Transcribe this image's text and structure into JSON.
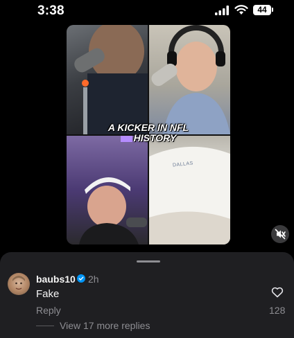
{
  "status_bar": {
    "time": "3:38",
    "battery": "44"
  },
  "video": {
    "caption_line1": "A KICKER IN NFL",
    "caption_line2": "HISTORY",
    "background_text": "DALLAS"
  },
  "comment": {
    "username": "baubs10",
    "time_ago": "2h",
    "text": "Fake",
    "reply_label": "Reply",
    "like_count": "128",
    "view_replies": "View 17 more replies"
  },
  "colors": {
    "background": "#000000",
    "sheet": "#1f1f22",
    "secondary_text": "#8e8e93",
    "verified_badge": "#0095f6",
    "caption_accent": "#b58cff"
  },
  "icons": [
    "signal-icon",
    "wifi-icon",
    "battery-icon",
    "mute-icon",
    "verified-icon",
    "heart-icon"
  ]
}
